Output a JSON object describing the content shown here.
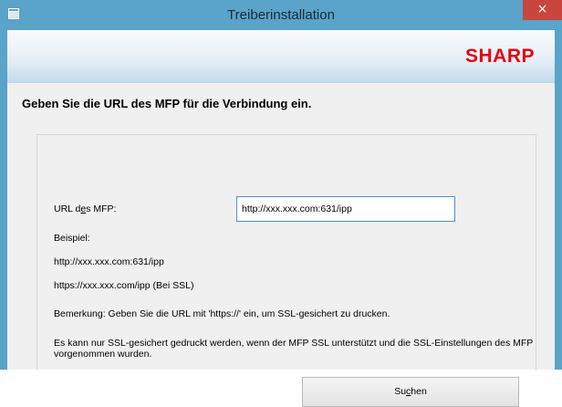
{
  "window": {
    "title": "Treiberinstallation",
    "close_label": "×",
    "titlebar_color": "#5aa3c9"
  },
  "banner": {
    "brand": "SHARP",
    "brand_color": "#e60012"
  },
  "form": {
    "heading": "Geben Sie die URL des MFP für die Verbindung ein.",
    "url_label_prefix": "URL d",
    "url_label_underlined": "e",
    "url_label_suffix": "s MFP:",
    "url_value": "http://xxx.xxx.com:631/ipp",
    "example_label": "Beispiel:",
    "example_1": "http://xxx.xxx.com:631/ipp",
    "example_2": "https://xxx.xxx.com/ipp (Bei SSL)",
    "remark": "Bemerkung: Geben Sie die URL mit 'https://' ein, um SSL-gesichert zu drucken.",
    "ssl_note": "Es kann nur SSL-gesichert gedruckt werden, wenn der MFP SSL unterstützt und die SSL-Einstellungen des MFP vorgenommen wurden.",
    "search_prefix": "Su",
    "search_underlined": "c",
    "search_suffix": "hen"
  },
  "icons": {
    "app": "window-app-icon",
    "close": "close-icon"
  }
}
